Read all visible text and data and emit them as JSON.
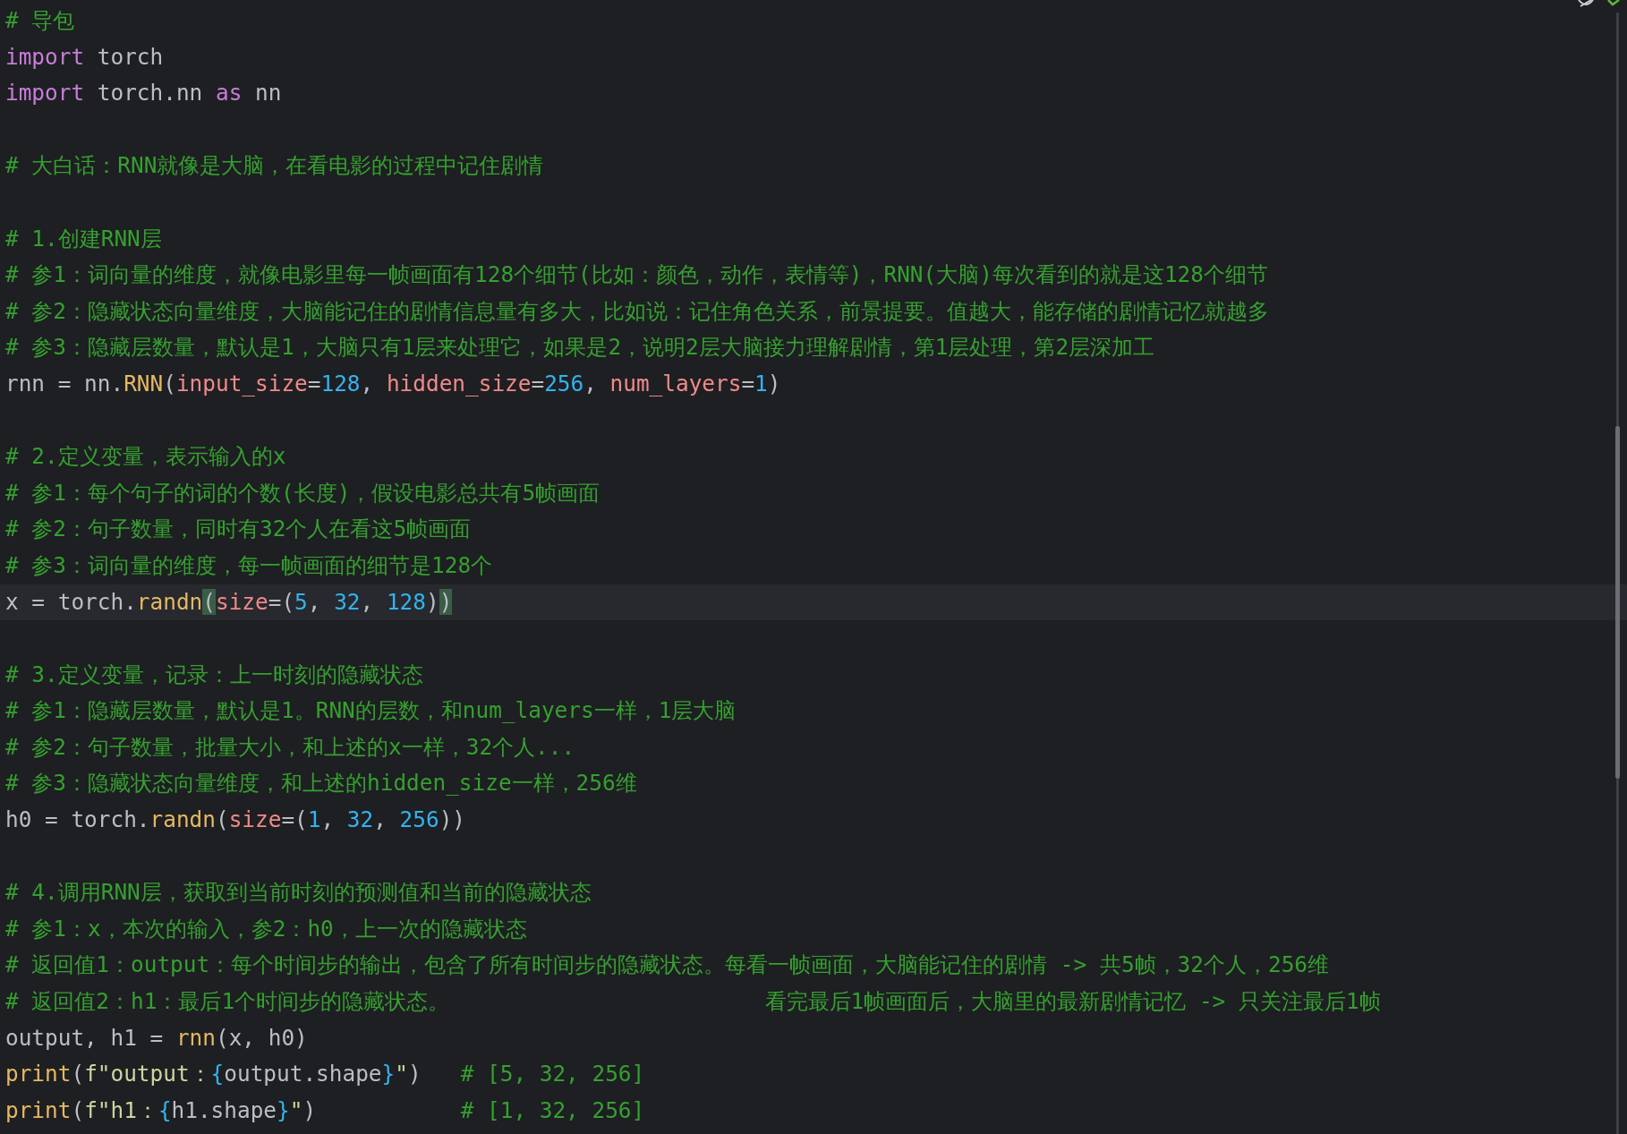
{
  "editor": {
    "lines": [
      {
        "kind": "code",
        "current": false,
        "tokens": [
          {
            "kind": "comment",
            "text": "# 导包"
          }
        ]
      },
      {
        "kind": "code",
        "current": false,
        "tokens": [
          {
            "kind": "keyword",
            "text": "import"
          },
          {
            "kind": "plain",
            "text": " torch"
          }
        ]
      },
      {
        "kind": "code",
        "current": false,
        "tokens": [
          {
            "kind": "keyword",
            "text": "import"
          },
          {
            "kind": "plain",
            "text": " torch.nn "
          },
          {
            "kind": "keyword",
            "text": "as"
          },
          {
            "kind": "plain",
            "text": " nn"
          }
        ]
      },
      {
        "kind": "blank"
      },
      {
        "kind": "code",
        "current": false,
        "tokens": [
          {
            "kind": "comment",
            "text": "# 大白话：RNN就像是大脑，在看电影的过程中记住剧情"
          }
        ]
      },
      {
        "kind": "blank"
      },
      {
        "kind": "code",
        "current": false,
        "tokens": [
          {
            "kind": "comment",
            "text": "# 1.创建RNN层"
          }
        ]
      },
      {
        "kind": "code",
        "current": false,
        "tokens": [
          {
            "kind": "comment",
            "text": "# 参1：词向量的维度，就像电影里每一帧画面有128个细节(比如：颜色，动作，表情等)，RNN(大脑)每次看到的就是这128个细节"
          }
        ]
      },
      {
        "kind": "code",
        "current": false,
        "tokens": [
          {
            "kind": "comment",
            "text": "# 参2：隐藏状态向量维度，大脑能记住的剧情信息量有多大，比如说：记住角色关系，前景提要。值越大，能存储的剧情记忆就越多"
          }
        ]
      },
      {
        "kind": "code",
        "current": false,
        "tokens": [
          {
            "kind": "comment",
            "text": "# 参3：隐藏层数量，默认是1，大脑只有1层来处理它，如果是2，说明2层大脑接力理解剧情，第1层处理，第2层深加工"
          }
        ]
      },
      {
        "kind": "code",
        "current": false,
        "tokens": [
          {
            "kind": "plain",
            "text": "rnn = nn."
          },
          {
            "kind": "function",
            "text": "RNN"
          },
          {
            "kind": "plain",
            "text": "("
          },
          {
            "kind": "param",
            "text": "input_size"
          },
          {
            "kind": "plain",
            "text": "="
          },
          {
            "kind": "number",
            "text": "128"
          },
          {
            "kind": "plain",
            "text": ", "
          },
          {
            "kind": "param",
            "text": "hidden_size"
          },
          {
            "kind": "plain",
            "text": "="
          },
          {
            "kind": "number",
            "text": "256"
          },
          {
            "kind": "plain",
            "text": ", "
          },
          {
            "kind": "param",
            "text": "num_layers"
          },
          {
            "kind": "plain",
            "text": "="
          },
          {
            "kind": "number",
            "text": "1"
          },
          {
            "kind": "plain",
            "text": ")"
          }
        ]
      },
      {
        "kind": "blank"
      },
      {
        "kind": "code",
        "current": false,
        "tokens": [
          {
            "kind": "comment",
            "text": "# 2.定义变量，表示输入的x"
          }
        ]
      },
      {
        "kind": "code",
        "current": false,
        "tokens": [
          {
            "kind": "comment",
            "text": "# 参1：每个句子的词的个数(长度)，假设电影总共有5帧画面"
          }
        ]
      },
      {
        "kind": "code",
        "current": false,
        "tokens": [
          {
            "kind": "comment",
            "text": "# 参2：句子数量，同时有32个人在看这5帧画面"
          }
        ]
      },
      {
        "kind": "code",
        "current": false,
        "tokens": [
          {
            "kind": "comment",
            "text": "# 参3：词向量的维度，每一帧画面的细节是128个"
          }
        ]
      },
      {
        "kind": "code",
        "current": true,
        "tokens": [
          {
            "kind": "plain",
            "text": "x = torch."
          },
          {
            "kind": "function",
            "text": "randn"
          },
          {
            "kind": "matched-bracket",
            "text": "("
          },
          {
            "kind": "param",
            "text": "size"
          },
          {
            "kind": "plain",
            "text": "=("
          },
          {
            "kind": "number",
            "text": "5"
          },
          {
            "kind": "plain",
            "text": ", "
          },
          {
            "kind": "number",
            "text": "32"
          },
          {
            "kind": "plain",
            "text": ", "
          },
          {
            "kind": "number",
            "text": "128"
          },
          {
            "kind": "plain",
            "text": ")"
          },
          {
            "kind": "matched-bracket",
            "text": ")"
          }
        ]
      },
      {
        "kind": "blank"
      },
      {
        "kind": "code",
        "current": false,
        "tokens": [
          {
            "kind": "comment",
            "text": "# 3.定义变量，记录：上一时刻的隐藏状态"
          }
        ]
      },
      {
        "kind": "code",
        "current": false,
        "tokens": [
          {
            "kind": "comment",
            "text": "# 参1：隐藏层数量，默认是1。RNN的层数，和num_layers一样，1层大脑"
          }
        ]
      },
      {
        "kind": "code",
        "current": false,
        "tokens": [
          {
            "kind": "comment",
            "text": "# 参2：句子数量，批量大小，和上述的x一样，32个人..."
          }
        ]
      },
      {
        "kind": "code",
        "current": false,
        "tokens": [
          {
            "kind": "comment",
            "text": "# 参3：隐藏状态向量维度，和上述的hidden_size一样，256维"
          }
        ]
      },
      {
        "kind": "code",
        "current": false,
        "tokens": [
          {
            "kind": "plain",
            "text": "h0 = torch."
          },
          {
            "kind": "function",
            "text": "randn"
          },
          {
            "kind": "plain",
            "text": "("
          },
          {
            "kind": "param",
            "text": "size"
          },
          {
            "kind": "plain",
            "text": "=("
          },
          {
            "kind": "number",
            "text": "1"
          },
          {
            "kind": "plain",
            "text": ", "
          },
          {
            "kind": "number",
            "text": "32"
          },
          {
            "kind": "plain",
            "text": ", "
          },
          {
            "kind": "number",
            "text": "256"
          },
          {
            "kind": "plain",
            "text": "))"
          }
        ]
      },
      {
        "kind": "blank"
      },
      {
        "kind": "code",
        "current": false,
        "tokens": [
          {
            "kind": "comment",
            "text": "# 4.调用RNN层，获取到当前时刻的预测值和当前的隐藏状态"
          }
        ]
      },
      {
        "kind": "code",
        "current": false,
        "tokens": [
          {
            "kind": "comment",
            "text": "# 参1：x，本次的输入，参2：h0，上一次的隐藏状态"
          }
        ]
      },
      {
        "kind": "code",
        "current": false,
        "tokens": [
          {
            "kind": "comment",
            "text": "# 返回值1：output：每个时间步的输出，包含了所有时间步的隐藏状态。每看一帧画面，大脑能记住的剧情 -> 共5帧，32个人，256维"
          }
        ]
      },
      {
        "kind": "code",
        "current": false,
        "tokens": [
          {
            "kind": "comment",
            "text": "# 返回值2：h1：最后1个时间步的隐藏状态。                        看完最后1帧画面后，大脑里的最新剧情记忆 -> 只关注最后1帧"
          }
        ]
      },
      {
        "kind": "code",
        "current": false,
        "tokens": [
          {
            "kind": "plain",
            "text": "output, h1 = "
          },
          {
            "kind": "function",
            "text": "rnn"
          },
          {
            "kind": "plain",
            "text": "(x, h0)"
          }
        ]
      },
      {
        "kind": "code",
        "current": false,
        "tokens": [
          {
            "kind": "function",
            "text": "print"
          },
          {
            "kind": "plain",
            "text": "("
          },
          {
            "kind": "string",
            "text": "f\"output："
          },
          {
            "kind": "brace",
            "text": "{"
          },
          {
            "kind": "plain",
            "text": "output.shape"
          },
          {
            "kind": "brace",
            "text": "}"
          },
          {
            "kind": "string",
            "text": "\""
          },
          {
            "kind": "plain",
            "text": ")   "
          },
          {
            "kind": "comment",
            "text": "# [5, 32, 256]"
          }
        ]
      },
      {
        "kind": "code",
        "current": false,
        "tokens": [
          {
            "kind": "function",
            "text": "print"
          },
          {
            "kind": "plain",
            "text": "("
          },
          {
            "kind": "string",
            "text": "f\"h1："
          },
          {
            "kind": "brace",
            "text": "{"
          },
          {
            "kind": "plain",
            "text": "h1.shape"
          },
          {
            "kind": "brace",
            "text": "}"
          },
          {
            "kind": "string",
            "text": "\""
          },
          {
            "kind": "plain",
            "text": ")           "
          },
          {
            "kind": "comment",
            "text": "# [1, 32, 256]"
          }
        ]
      }
    ]
  }
}
